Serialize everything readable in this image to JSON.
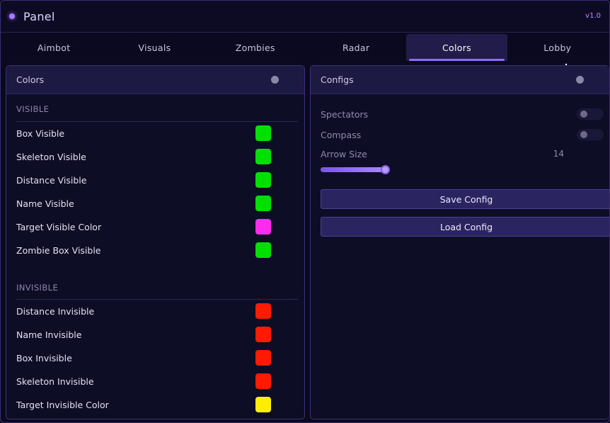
{
  "window": {
    "title": "Panel",
    "version": "v1.0"
  },
  "tabs": [
    {
      "label": "Aimbot",
      "active": false
    },
    {
      "label": "Visuals",
      "active": false
    },
    {
      "label": "Zombies",
      "active": false
    },
    {
      "label": "Radar",
      "active": false
    },
    {
      "label": "Colors",
      "active": true
    },
    {
      "label": "Lobby",
      "active": false
    }
  ],
  "colors_panel": {
    "title": "Colors",
    "visible_section": "VISIBLE",
    "visible_items": [
      {
        "label": "Box Visible",
        "color": "#00e000"
      },
      {
        "label": "Skeleton Visible",
        "color": "#00e000"
      },
      {
        "label": "Distance Visible",
        "color": "#00e000"
      },
      {
        "label": "Name Visible",
        "color": "#00e000"
      },
      {
        "label": "Target Visible Color",
        "color": "#ff2cf0"
      },
      {
        "label": "Zombie Box Visible",
        "color": "#00e000"
      }
    ],
    "invisible_section": "INVISIBLE",
    "invisible_items": [
      {
        "label": "Distance Invisible",
        "color": "#ff1a00"
      },
      {
        "label": "Name Invisible",
        "color": "#ff1a00"
      },
      {
        "label": "Box Invisible",
        "color": "#ff1a00"
      },
      {
        "label": "Skeleton Invisible",
        "color": "#ff1a00"
      },
      {
        "label": "Target Invisible Color",
        "color": "#ffee00"
      }
    ]
  },
  "configs_panel": {
    "title": "Configs",
    "spectators_label": "Spectators",
    "spectators_on": false,
    "compass_label": "Compass",
    "compass_on": false,
    "arrow_size_label": "Arrow Size",
    "arrow_size_value": "14",
    "arrow_size_fraction": 0.95,
    "save_label": "Save Config",
    "load_label": "Load Config"
  },
  "colors": {
    "accent": "#8f6bff",
    "background": "#0a0920",
    "panel_header": "#1c1a42"
  }
}
